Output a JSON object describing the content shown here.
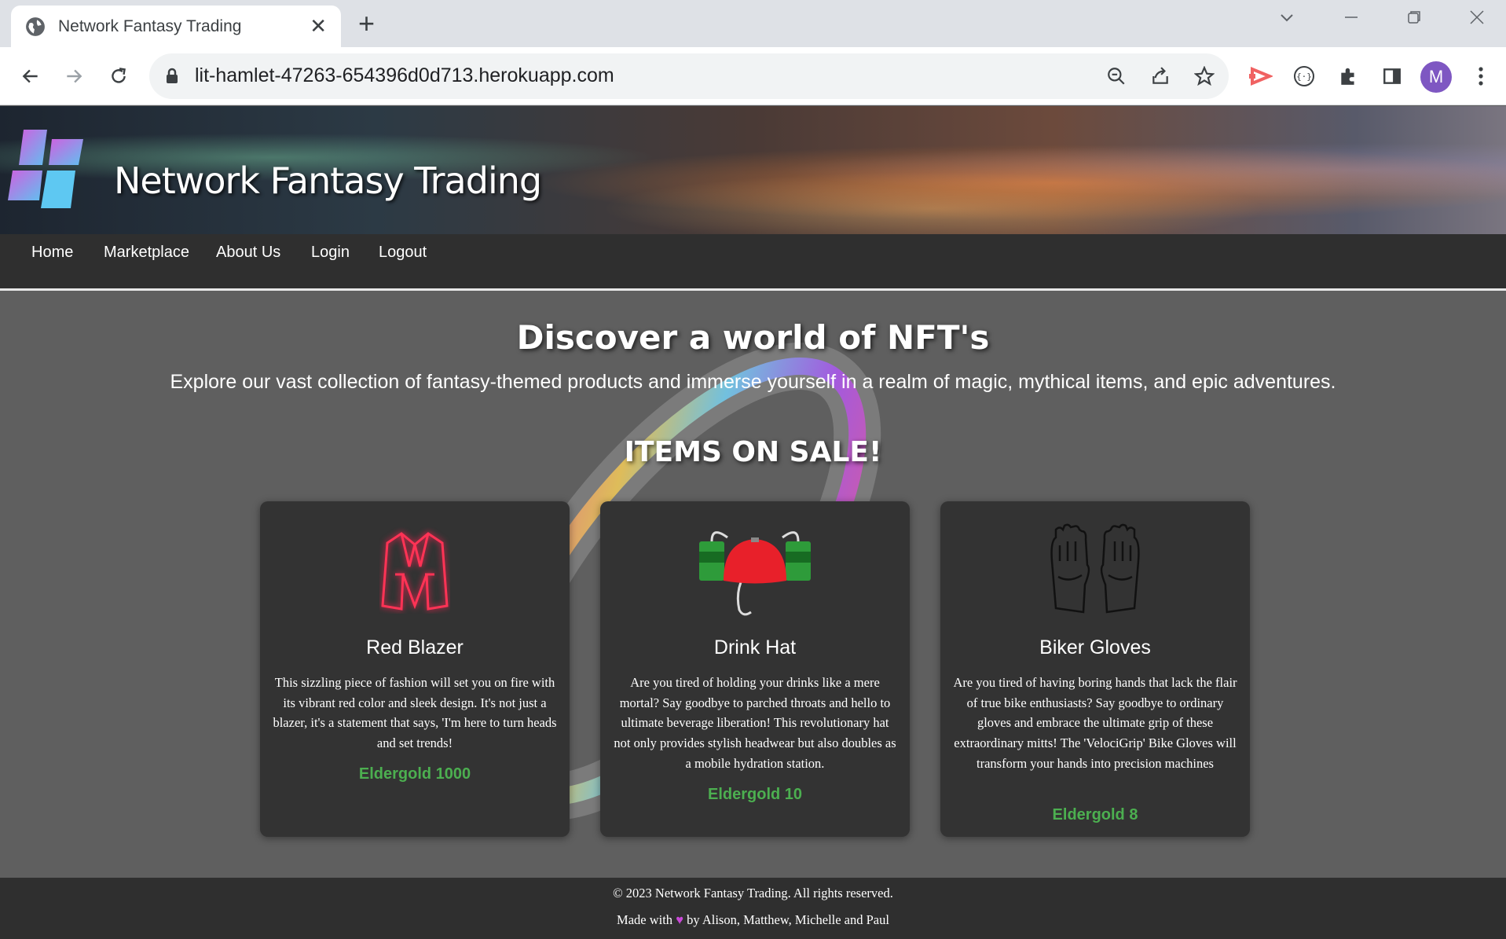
{
  "browser": {
    "tab_title": "Network Fantasy Trading",
    "new_tab": "+",
    "url": "lit-hamlet-47263-654396d0d713.herokuapp.com",
    "profile_initial": "M"
  },
  "site": {
    "title": "Network Fantasy Trading",
    "nav": [
      "Home",
      "Marketplace",
      "About Us",
      "Login",
      "Logout"
    ]
  },
  "hero": {
    "title": "Discover a world of NFT's",
    "subtitle": "Explore our vast collection of fantasy-themed products and immerse yourself in a realm of magic, mythical items, and epic adventures."
  },
  "section_title": "ITEMS ON SALE!",
  "products": [
    {
      "name": "Red Blazer",
      "description": "This sizzling piece of fashion will set you on fire with its vibrant red color and sleek design. It's not just a blazer, it's a statement that says, 'I'm here to turn heads and set trends!",
      "price": "Eldergold 1000",
      "icon": "red-blazer-icon"
    },
    {
      "name": "Drink Hat",
      "description": "Are you tired of holding your drinks like a mere mortal? Say goodbye to parched throats and hello to ultimate beverage liberation! This revolutionary hat not only provides stylish headwear but also doubles as a mobile hydration station.",
      "price": "Eldergold 10",
      "icon": "drink-hat-icon"
    },
    {
      "name": "Biker Gloves",
      "description": "Are you tired of having boring hands that lack the flair of true bike enthusiasts? Say goodbye to ordinary gloves and embrace the ultimate grip of these extraordinary mitts! The 'VelociGrip' Bike Gloves will transform your hands into precision machines",
      "price": "Eldergold 8",
      "icon": "biker-gloves-icon"
    }
  ],
  "footer": {
    "copyright": "© 2023 Network Fantasy Trading. All rights reserved.",
    "made_with": "Made with",
    "heart": "♥",
    "credits": "by Alison, Matthew, Michelle and Paul"
  },
  "colors": {
    "price_green": "#4caf50",
    "card_bg": "#333333",
    "page_bg": "#5f5f5f",
    "nav_bg": "#2f2f2f",
    "heart": "#c948d8",
    "avatar": "#7e57c2"
  }
}
